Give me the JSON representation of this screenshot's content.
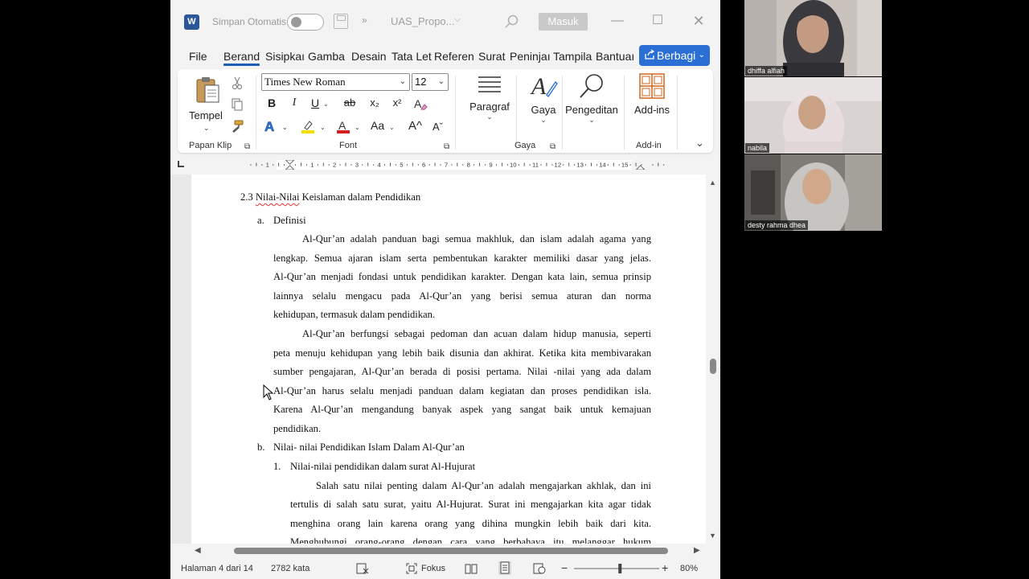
{
  "titlebar": {
    "app_icon": "W",
    "autosave_label": "Simpan Otomatis",
    "more_glyph": "»",
    "doc_title": "UAS_Propo...",
    "signin_label": "Masuk",
    "minimize": "—",
    "maximize": "☐",
    "close": "✕"
  },
  "tabs": [
    "File",
    "Berand",
    "Sisipkaı",
    "Gamba",
    "Desain",
    "Tata Let",
    "Referen",
    "Surat",
    "Peninjaı",
    "Tampila",
    "Bantuaı"
  ],
  "share_label": "Berbagi",
  "ribbon": {
    "paste_label": "Tempel",
    "clipboard_group": "Papan Klip",
    "font_name": "Times New Roman",
    "font_size": "12",
    "bold": "B",
    "italic": "I",
    "underline": "U",
    "strike": "ab",
    "subscript": "x₂",
    "superscript": "x²",
    "case": "Aa",
    "grow": "A^",
    "shrink": "Aˇ",
    "font_group": "Font",
    "paragraph_label": "Paragraf",
    "styles_label": "Gaya",
    "styles_group": "Gaya",
    "editing_label": "Pengeditan",
    "addins_label": "Add-ins",
    "addins_group": "Add-in"
  },
  "ruler_numbers": [
    "1",
    "1",
    "2",
    "3",
    "4",
    "5",
    "6",
    "7",
    "8",
    "9",
    "10",
    "11",
    "12",
    "13",
    "14",
    "15"
  ],
  "document": {
    "heading": "2.3 Nilai-Nilai Keislaman dalam Pendidikan",
    "a_marker": "a.",
    "a_title": "Definisi",
    "p1": [
      "Al-Qur’an adalah panduan bagi semua  makhluk, dan islam adalah agama yang",
      "lengkap. Semua ajaran islam serta pembentukan karakter memiliki dasar yang jelas.",
      "Al-Qur’an menjadi fondasi untuk pendidikan karakter. Dengan kata lain, semua prinsip",
      "lainnya selalu mengacu pada Al-Qur’an yang berisi semua aturan dan norma",
      "kehidupan, termasuk dalam pendidikan."
    ],
    "p2": [
      "Al-Qur’an berfungsi sebagai pedoman dan acuan dalam hidup manusia, seperti",
      "peta menuju kehidupan yang lebih baik disunia dan akhirat. Ketika kita membivarakan",
      "sumber pengajaran, Al-Qur’an berada di posisi pertama. Nilai -nilai yang ada dalam",
      "Al-Qur’an harus selalu menjadi panduan dalam kegiatan dan proses pendidikan isla.",
      "Karena Al-Qur’an mengandung banyak aspek yang sangat baik untuk kemajuan",
      "pendidikan."
    ],
    "b_marker": "b.",
    "b_title": "Nilai- nilai Pendidikan Islam Dalam Al-Qur’an",
    "n1_marker": "1.",
    "n1_title": "Nilai-nilai pendidikan dalam surat Al-Hujurat",
    "p3": [
      "Salah satu nilai penting dalam Al-Qur’an adalah mengajarkan akhlak, dan ini",
      "tertulis di salah satu surat, yaitu Al-Hujurat. Surat ini mengajarkan kita agar tidak",
      "menghina orang lain karena orang yang dihina mungkin lebih baik dari kita.",
      "Menghubungi orang-orang dengan cara yang  berbahaya itu melanggar hukum"
    ]
  },
  "statusbar": {
    "page": "Halaman 4 dari 14",
    "words": "2782 kata",
    "focus": "Fokus",
    "zoom": "80%",
    "zoom_level": 0.54
  },
  "participants": [
    {
      "name": "dhiffa alfiah"
    },
    {
      "name": "nabila"
    },
    {
      "name": "desty rahma dhea"
    }
  ],
  "colors": {
    "accent": "#1a5fb4",
    "share": "#2b6fd4",
    "word_blue": "#2b579a"
  }
}
